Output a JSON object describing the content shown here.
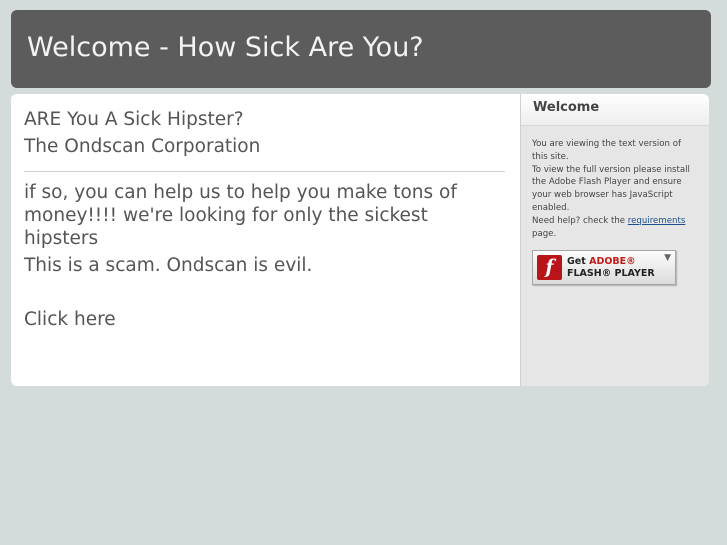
{
  "header": {
    "title": "Welcome - How Sick Are You?"
  },
  "main": {
    "heading1": "ARE You A Sick Hipster?",
    "heading2": "The Ondscan Corporation",
    "paragraph": "if so, you can help us to help you make tons of money!!!! we're looking for only the sickest hipsters",
    "scam_line": "This is a scam. Ondscan is evil.",
    "click_link": "Click here"
  },
  "sidebar": {
    "title": "Welcome",
    "line1": "You are viewing the text version of this site.",
    "line2": "To view the full version please install the Adobe Flash Player and ensure your web browser has JavaScript enabled.",
    "help_prefix": "Need help? check the ",
    "help_link": "requirements",
    "help_suffix": " page.",
    "flash_badge": {
      "get": "Get ",
      "adobe": "ADOBE®",
      "player": "FLASH® PLAYER",
      "logo_letter": "f",
      "logo_icon": "flash-logo-icon",
      "download_icon": "download-arrow-icon",
      "logo_color": "#b8141a",
      "adobe_color": "#c21b17"
    }
  }
}
